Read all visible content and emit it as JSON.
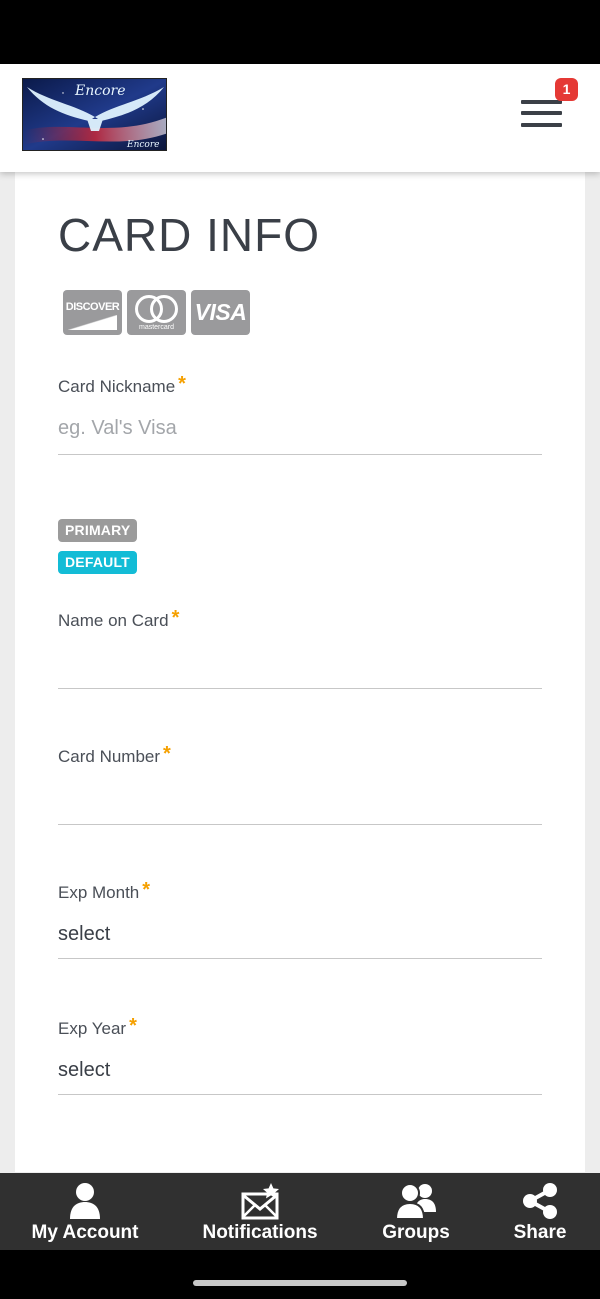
{
  "header": {
    "logo_text": "Encore",
    "notification_count": "1"
  },
  "page": {
    "title": "CARD INFO"
  },
  "card_brands": {
    "discover": "DISCOVER",
    "mastercard": "mastercard",
    "visa": "VISA"
  },
  "form": {
    "nickname": {
      "label": "Card Nickname",
      "placeholder": "eg. Val's Visa",
      "value": ""
    },
    "tags": {
      "primary": "PRIMARY",
      "default": "DEFAULT"
    },
    "name_on_card": {
      "label": "Name on Card",
      "value": ""
    },
    "card_number": {
      "label": "Card Number",
      "value": ""
    },
    "exp_month": {
      "label": "Exp Month",
      "value": "select"
    },
    "exp_year": {
      "label": "Exp Year",
      "value": "select"
    },
    "required_mark": "*"
  },
  "bottom_nav": {
    "my_account": "My Account",
    "notifications": "Notifications",
    "groups": "Groups",
    "share": "Share"
  },
  "colors": {
    "accent_required": "#f5a000",
    "tag_primary": "#9b9b9b",
    "tag_default": "#13bcd6",
    "badge": "#e53935",
    "nav_background": "#303030"
  }
}
